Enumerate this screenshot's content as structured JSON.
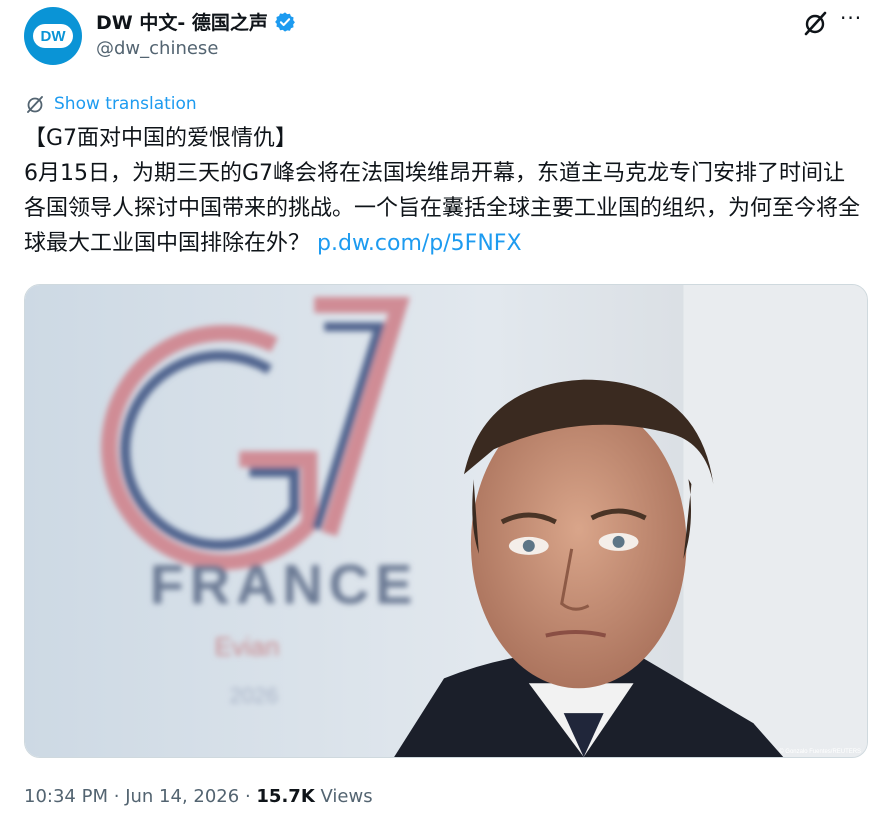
{
  "account": {
    "display_name": "DW 中文- 德国之声",
    "handle": "@dw_chinese",
    "avatar_text": "DW",
    "verified": true
  },
  "tweet": {
    "show_translation": "Show translation",
    "text": "【G7面对中国的爱恨情仇】\n6月15日，为期三天的G7峰会将在法国埃维昂开幕，东道主马克龙专门安排了时间让各国领导人探讨中国带来的挑战。一个旨在囊括全球主要工业国的组织，为何至今将全球最大工业国中国排除在外？",
    "link": "p.dw.com/p/5FNFX"
  },
  "media": {
    "sign_main": "G7",
    "sign_country": "FRANCE",
    "sign_city": "Evian",
    "sign_year": "2026",
    "photo_credit": "© Gonzalo Fuentes/REUTERS"
  },
  "meta": {
    "time": "10:34 PM",
    "date": "Jun 14, 2026",
    "views_count": "15.7K",
    "views_label": "Views",
    "separator": "·"
  },
  "colors": {
    "accent": "#1d9bf0",
    "brand": "#0a94d6",
    "text": "#0f1419",
    "secondary": "#536471"
  },
  "icons": [
    "dw-logo-icon",
    "verified-badge-icon",
    "grok-icon",
    "more-icon",
    "translate-icon"
  ]
}
